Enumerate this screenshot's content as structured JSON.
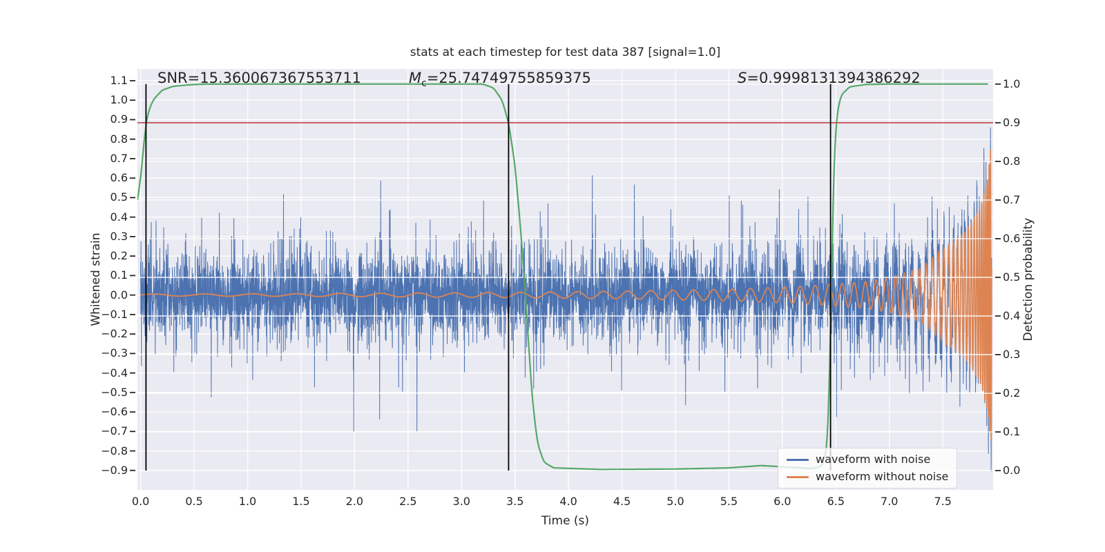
{
  "figure": {
    "title": "stats at each timestep for test data 387 [signal=1.0]",
    "stats_annotations": [
      {
        "pre": "SNR",
        "sub": "",
        "rest": "=15.360067367553711"
      },
      {
        "pre": "M",
        "sub": "c",
        "rest": "=25.74749755859375"
      },
      {
        "pre": "S",
        "sub": "",
        "rest": "=0.9998131394386292"
      }
    ]
  },
  "axes": {
    "xlabel": "Time (s)",
    "ylabel_left": "Whitened strain",
    "ylabel_right": "Detection probability",
    "x_tick_values": [
      0.0,
      0.5,
      1.0,
      1.5,
      2.0,
      2.5,
      3.0,
      3.5,
      4.0,
      4.5,
      5.0,
      5.5,
      6.0,
      6.5,
      7.0,
      7.5
    ],
    "x_tick_labels": [
      "0.0",
      "0.5",
      "1.0",
      "1.5",
      "2.0",
      "2.5",
      "3.0",
      "3.5",
      "4.0",
      "4.5",
      "5.0",
      "5.5",
      "6.0",
      "6.5",
      "7.0",
      "7.5"
    ],
    "y_left_tick_values": [
      1.1,
      1.0,
      0.9,
      0.8,
      0.7,
      0.6,
      0.5,
      0.4,
      0.3,
      0.2,
      0.1,
      0.0,
      -0.1,
      -0.2,
      -0.3,
      -0.4,
      -0.5,
      -0.6,
      -0.7,
      -0.8,
      -0.9
    ],
    "y_left_tick_labels": [
      "1.1",
      "1.0",
      "0.9",
      "0.8",
      "0.7",
      "0.6",
      "0.5",
      "0.4",
      "0.3",
      "0.2",
      "0.1",
      "0.0",
      "−0.1",
      "−0.2",
      "−0.3",
      "−0.4",
      "−0.5",
      "−0.6",
      "−0.7",
      "−0.8",
      "−0.9"
    ],
    "y_right_tick_values": [
      1.0,
      0.9,
      0.8,
      0.7,
      0.6,
      0.5,
      0.4,
      0.3,
      0.2,
      0.1,
      0.0
    ],
    "y_right_tick_labels": [
      "1.0",
      "0.9",
      "0.8",
      "0.7",
      "0.6",
      "0.5",
      "0.4",
      "0.3",
      "0.2",
      "0.1",
      "0.0"
    ]
  },
  "legend": {
    "items": [
      {
        "label": "waveform with noise",
        "color": "#4C72B0"
      },
      {
        "label": "waveform without noise",
        "color": "#DD8452"
      }
    ]
  },
  "style_colors": {
    "axes_background": "#EAEAF2",
    "grid": "#FFFFFF",
    "text": "#262626",
    "tick_mark": "#262626"
  },
  "chart_data": {
    "type": "line",
    "title": "stats at each timestep for test data 387 [signal=1.0]",
    "xlabel": "Time (s)",
    "ylabel_left": "Whitened strain",
    "ylabel_right": "Detection probability",
    "xlim": [
      -0.03,
      7.97
    ],
    "ylim_left": [
      -1.0,
      1.16
    ],
    "ylim_right": [
      -0.05,
      1.039
    ],
    "grid": true,
    "legend_position": "lower right",
    "stats": {
      "test_index": 387,
      "signal": 1.0,
      "SNR": 15.360067367553711,
      "chirp_mass_Mc": 25.74749755859375,
      "S": 0.9998131394386292
    },
    "threshold_line": {
      "axis": "right",
      "value": 0.9,
      "color": "#C44E52"
    },
    "event_vlines": {
      "x": [
        0.05,
        3.44,
        6.45
      ],
      "span_right_axis": [
        0.0,
        1.0
      ],
      "color": "#000000"
    },
    "series": [
      {
        "name": "waveform with noise",
        "axis": "left",
        "color": "#4C72B0",
        "type": "synthetic-noise-plus-signal",
        "noise": {
          "n": 6000,
          "t_start": 0.0,
          "t_end": 7.955,
          "sigma_core": 0.095,
          "sigma_tail": 0.21,
          "tail_fraction": 0.15,
          "seed": 387
        }
      },
      {
        "name": "waveform without noise",
        "axis": "left",
        "color": "#DD8452",
        "type": "synthetic-chirp",
        "envelope_keypoints": [
          [
            0.0,
            0.005
          ],
          [
            1.5,
            0.007
          ],
          [
            2.5,
            0.01
          ],
          [
            3.4,
            0.013
          ],
          [
            4.5,
            0.02
          ],
          [
            5.5,
            0.03
          ],
          [
            6.0,
            0.04
          ],
          [
            6.4,
            0.052
          ],
          [
            6.8,
            0.07
          ],
          [
            7.0,
            0.09
          ],
          [
            7.3,
            0.14
          ],
          [
            7.5,
            0.24
          ],
          [
            7.7,
            0.32
          ],
          [
            7.85,
            0.45
          ],
          [
            7.92,
            0.6
          ],
          [
            7.955,
            0.8
          ]
        ],
        "frequency_keypoints_hz": [
          [
            0.0,
            2.0
          ],
          [
            2.0,
            2.6
          ],
          [
            3.4,
            3.3
          ],
          [
            5.0,
            5.0
          ],
          [
            6.0,
            6.5
          ],
          [
            6.4,
            7.7
          ],
          [
            7.0,
            11
          ],
          [
            7.4,
            17
          ],
          [
            7.6,
            24
          ],
          [
            7.8,
            38
          ],
          [
            7.9,
            55
          ],
          [
            7.955,
            85
          ]
        ]
      },
      {
        "name": "detection probability",
        "axis": "right",
        "color": "#55A868",
        "type": "keypoint-curve",
        "keypoints": [
          [
            -0.03,
            0.7
          ],
          [
            0.0,
            0.755
          ],
          [
            0.03,
            0.845
          ],
          [
            0.05,
            0.9
          ],
          [
            0.08,
            0.935
          ],
          [
            0.12,
            0.96
          ],
          [
            0.2,
            0.984
          ],
          [
            0.3,
            0.994
          ],
          [
            0.45,
            0.998
          ],
          [
            0.6,
            1.0
          ],
          [
            3.2,
            1.0
          ],
          [
            3.3,
            0.99
          ],
          [
            3.38,
            0.958
          ],
          [
            3.44,
            0.9
          ],
          [
            3.5,
            0.79
          ],
          [
            3.56,
            0.6
          ],
          [
            3.61,
            0.4
          ],
          [
            3.66,
            0.19
          ],
          [
            3.71,
            0.07
          ],
          [
            3.77,
            0.022
          ],
          [
            3.86,
            0.007
          ],
          [
            4.3,
            0.003
          ],
          [
            5.0,
            0.004
          ],
          [
            5.5,
            0.007
          ],
          [
            5.8,
            0.013
          ],
          [
            6.05,
            0.009
          ],
          [
            6.28,
            0.005
          ],
          [
            6.37,
            0.012
          ],
          [
            6.42,
            0.06
          ],
          [
            6.445,
            0.28
          ],
          [
            6.465,
            0.6
          ],
          [
            6.485,
            0.82
          ],
          [
            6.51,
            0.925
          ],
          [
            6.55,
            0.972
          ],
          [
            6.63,
            0.993
          ],
          [
            6.78,
            0.999
          ],
          [
            6.95,
            1.0
          ],
          [
            7.93,
            1.0
          ]
        ]
      }
    ]
  }
}
